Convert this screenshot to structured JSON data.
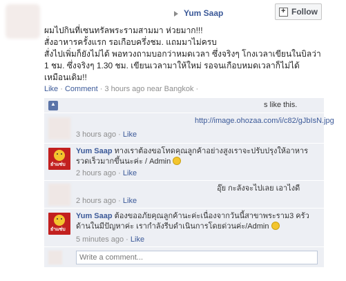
{
  "header": {
    "page_name": "Yum Saap",
    "follow_label": "Follow"
  },
  "post": {
    "lines": [
      "ผมไปกินที่เซนทรัลพระรามสามมา ห่วยมาก!!!",
      "สั่งอาหารครั้งแรก รอเกือบครึ่งชม. แถมมาไม่ครบ",
      "สั่งไปเพิ่มก็ยังไม่ได้ พอทวงถามบอกว่าหมดเวลา ซึ่งจริงๆ โกงเวลาเขียนในบิลว่า",
      "1 ชม. ซึ่งจริงๆ 1.30 ชม. เขียนเวลามาให้ใหม่ รอจนเกือบหมดเวลาก็ไม่ได้",
      "เหมือนเดิม!!"
    ],
    "meta": {
      "like": "Like",
      "sep1": " · ",
      "comment": "Comment",
      "sep2": " · ",
      "time": "3 hours ago near Bangkok",
      "sep3": " · "
    }
  },
  "likes": {
    "suffix": "s like this."
  },
  "comments": [
    {
      "author": "",
      "text": "http://image.ohozaa.com/i/c82/gJbIsN.jpg",
      "time": "3 hours ago",
      "sep": " · ",
      "like": "Like"
    },
    {
      "author": "Yum Saap",
      "text": "ทางเราต้องขอโทดคุณลูกค้าอย่างสูงเราจะปรับปรุงให้อาหาร รวดเร็วมากขึ้นนะค่ะ / Admin",
      "time": "2 hours ago",
      "sep": " · ",
      "like": "Like"
    },
    {
      "author": "",
      "text": "อุ๊ย กะลังจะไปเลย เอาไงดี",
      "time": "2 hours ago",
      "sep": " · ",
      "like": "Like"
    },
    {
      "author": "Yum Saap",
      "text": "ต้องขออภัยคุณลูกค้านะค่ะเนื่องจากวันนี้สาขาพระราม3 ครัว ด้านในมีปัญหาค่ะ เรากำลังรีบดำเนินการโดยด่วนค่ะ/Admin",
      "time": "5 minutes ago",
      "sep": " · ",
      "like": "Like"
    }
  ],
  "write_comment": {
    "placeholder": "Write a comment..."
  },
  "icons": {
    "follow": "follow-plus-icon",
    "like": "thumbs-up-icon",
    "header_arrow": "triangle-right-icon",
    "emoticon": "smiley-icon"
  },
  "colors": {
    "link": "#3b5998",
    "feedback_bg": "#edeff4",
    "brand_red": "#c2201f"
  }
}
